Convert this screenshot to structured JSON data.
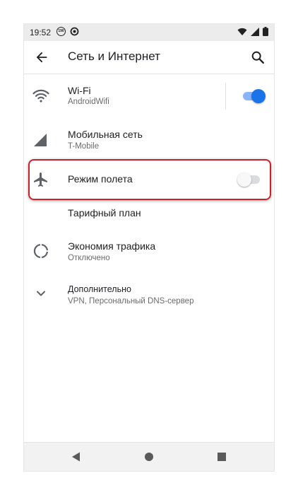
{
  "status_bar": {
    "time": "19:52",
    "notification_badge": "190",
    "icons": [
      "notification-badge-icon",
      "sync-icon",
      "wifi-icon",
      "signal-icon",
      "battery-icon"
    ]
  },
  "app_bar": {
    "title": "Сеть и Интернет",
    "back_icon": "arrow-back-icon",
    "search_icon": "search-icon"
  },
  "settings": [
    {
      "icon": "wifi-icon",
      "title": "Wi-Fi",
      "subtitle": "AndroidWifi",
      "toggle": true,
      "toggle_on": true
    },
    {
      "icon": "signal-icon",
      "title": "Мобильная сеть",
      "subtitle": "T-Mobile",
      "toggle": false
    },
    {
      "icon": "airplane-icon",
      "title": "Режим полета",
      "subtitle": "",
      "toggle": true,
      "toggle_on": false,
      "highlighted": true
    },
    {
      "icon": "",
      "title": "Тарифный план",
      "subtitle": "",
      "toggle": false
    },
    {
      "icon": "data-saver-icon",
      "title": "Экономия трафика",
      "subtitle": "Отключено",
      "toggle": false
    },
    {
      "icon": "chevron-down-icon",
      "title": "Дополнительно",
      "subtitle": "VPN, Персональный DNS-сервер",
      "toggle": false
    }
  ],
  "colors": {
    "accent": "#1a73e8",
    "accent_track": "#8ab4f8",
    "highlight_border": "#c8232c",
    "icon_gray": "#5f6368"
  },
  "nav_bar": {
    "buttons": [
      "back-triangle-icon",
      "home-circle-icon",
      "recents-square-icon"
    ]
  }
}
